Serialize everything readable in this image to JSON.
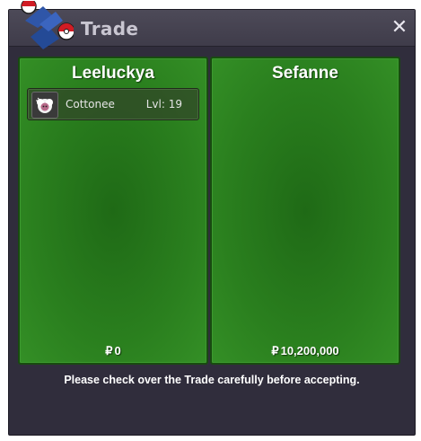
{
  "window": {
    "title": "Trade",
    "close_label": "✕"
  },
  "trade": {
    "left": {
      "player": "Leeluckya",
      "items": [
        {
          "name": "Cottonee",
          "level": "Lvl: 19",
          "icon": "cottonee-icon"
        }
      ],
      "currency_symbol": "₽",
      "money": "0"
    },
    "right": {
      "player": "Sefanne",
      "items": [],
      "currency_symbol": "₽",
      "money": "10,200,000"
    }
  },
  "footer": {
    "message": "Please check over the Trade carefully before accepting."
  },
  "colors": {
    "panel_green": "#2a7f1e",
    "window_bg": "#302d3c",
    "titlebar": "#4d4a58"
  }
}
